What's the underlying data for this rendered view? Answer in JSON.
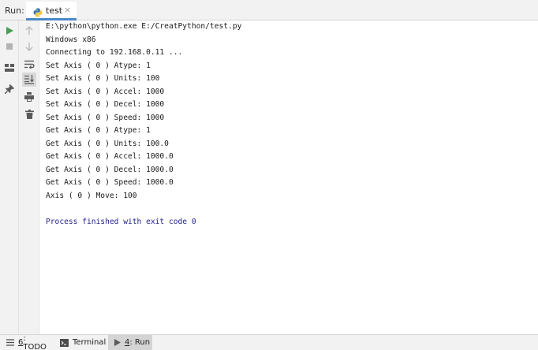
{
  "run_bar": {
    "label": "Run:",
    "tab_title": "test",
    "tab_close": "×"
  },
  "toolbar_left": [
    {
      "name": "run-icon"
    },
    {
      "name": "stop-icon"
    },
    {
      "name": "layout-icon"
    },
    {
      "name": "pin-icon"
    }
  ],
  "toolbar_right": [
    {
      "name": "up-arrow-icon"
    },
    {
      "name": "down-arrow-icon"
    },
    {
      "name": "soft-wrap-icon"
    },
    {
      "name": "scroll-to-end-icon"
    },
    {
      "name": "print-icon"
    },
    {
      "name": "trash-icon"
    }
  ],
  "console": {
    "command": "E:\\python\\python.exe E:/CreatPython/test.py",
    "lines": [
      "Windows x86",
      "Connecting to 192.168.0.11 ...",
      "Set Axis ( 0 ) Atype: 1",
      "Set Axis ( 0 ) Units: 100",
      "Set Axis ( 0 ) Accel: 1000",
      "Set Axis ( 0 ) Decel: 1000",
      "Set Axis ( 0 ) Speed: 1000",
      "Get Axis ( 0 ) Atype: 1",
      "Get Axis ( 0 ) Units: 100.0",
      "Get Axis ( 0 ) Accel: 1000.0",
      "Get Axis ( 0 ) Decel: 1000.0",
      "Get Axis ( 0 ) Speed: 1000.0",
      "Axis ( 0 ) Move: 100"
    ],
    "exit_message": "Process finished with exit code 0"
  },
  "bottom_tabs": {
    "todo_number": "6",
    "todo_text": ": TODO",
    "terminal": "Terminal",
    "run_number": "4",
    "run_text": ": Run"
  },
  "colors": {
    "accent": "#4a88c7",
    "run_green": "#499c54",
    "exit_text": "#23238e"
  }
}
